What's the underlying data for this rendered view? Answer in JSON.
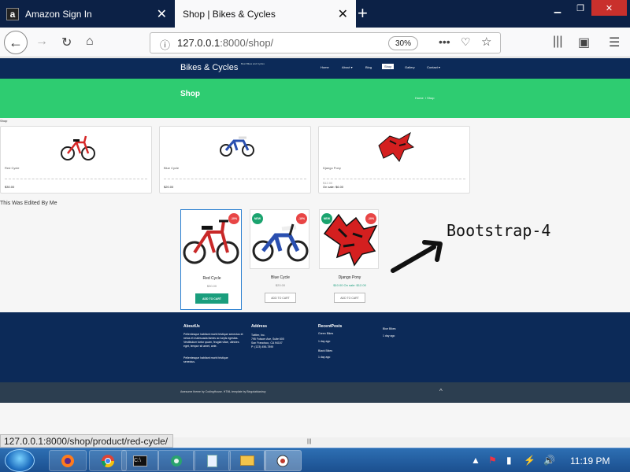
{
  "browser": {
    "tabs": [
      {
        "title": "Amazon Sign In",
        "icon": "amazon-logo-icon"
      },
      {
        "title": "Shop | Bikes & Cycles"
      }
    ],
    "new_tab_icon": "plus-icon",
    "url_host": "127.0.0.1",
    "url_path": ":8000/shop/",
    "zoom": "30%",
    "status_url": "127.0.0.1:8000/shop/product/red-cycle/",
    "window_controls": [
      "minimize-icon",
      "restore-icon",
      "close-icon"
    ]
  },
  "site": {
    "brand": "Bikes & Cycles",
    "tagline": "Best Bikes and Cycles",
    "menu": [
      "Home",
      "About ▾",
      "Blog",
      "Shop",
      "Gallery",
      "Contact ▾"
    ],
    "hero_title": "Shop",
    "breadcrumb": [
      "Home",
      "Shop"
    ],
    "shop_label": "Shop",
    "products_top": [
      {
        "name": "Red Cycle",
        "price": "$30.00",
        "old": ""
      },
      {
        "name": "Blue Cycle",
        "price": "$20.00",
        "old": ""
      },
      {
        "name": "Django Pony",
        "price": "On sale: $6.00",
        "old": "$12.00"
      }
    ],
    "edited_label": "This Was Edited By Me",
    "products_bottom": [
      {
        "name": "Red Cycle",
        "price": "$30.00",
        "badges": [
          "-10%"
        ],
        "button": "ADD TO CART"
      },
      {
        "name": "Blue Cycle",
        "price": "$20.00",
        "badges": [
          "NEW",
          "-10%"
        ],
        "button": "ADD TO CART"
      },
      {
        "name": "Django Pony",
        "price": "$10.00 On sale: $12.00",
        "badges": [
          "NEW",
          "-10%"
        ],
        "button": "ADD TO CART"
      }
    ],
    "annotation": "Bootstrap-4",
    "footer": {
      "about_title": "AboutUs",
      "about_text1": "Pellentesque habitant morbi tristique senectus et netus et malesuada fames ac turpis egestas. Vestibulum tortor quam, feugiat vitae, ultricies eget, tempor sit amet, ante.",
      "about_text2": "Pellentesque habitant morbi tristique senectus.",
      "address_title": "Address",
      "address_lines": [
        "Twitter, Inc.",
        "795 Folsom Ave, Suite 600",
        "San Francisco, CA 94107",
        "P: (123) 456-7890"
      ],
      "recent_title": "RecentPosts",
      "recent_posts": [
        {
          "title": "Green Bikes",
          "date": "1 day ago"
        },
        {
          "title": "Black Bikes",
          "date": "1 day ago"
        },
        {
          "title": "Blue Bikes",
          "date": "1 day ago"
        }
      ],
      "copyright": "Awesome theme by CodingHouse. HTML template by Bingotatdastroy",
      "top_arrow": "^"
    }
  },
  "taskbar": {
    "clock": "11:19 PM",
    "apps": [
      "firefox-icon",
      "chrome-icon",
      "cmd-icon",
      "settings-icon",
      "notepad-icon",
      "explorer-icon",
      "app-icon"
    ]
  },
  "colors": {
    "header": "#0c2a58",
    "hero": "#2ecc71",
    "accent": "#1a9e7d",
    "sale": "#e84545"
  }
}
